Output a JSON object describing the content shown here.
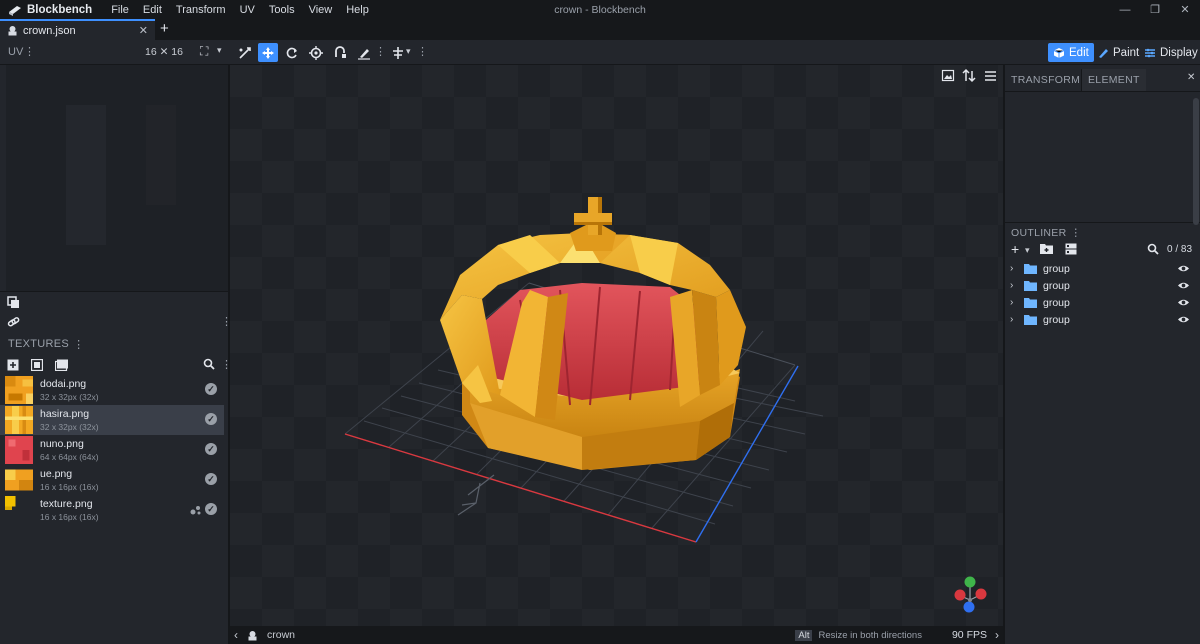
{
  "app": {
    "name": "Blockbench",
    "window_title": "crown - Blockbench",
    "menu": [
      "File",
      "Edit",
      "Transform",
      "UV",
      "Tools",
      "View",
      "Help"
    ]
  },
  "tab": {
    "label": "crown.json",
    "close": "✕",
    "new": "+"
  },
  "uv": {
    "label": "UV",
    "size": "16 ✕ 16"
  },
  "modes": {
    "edit": "Edit",
    "paint": "Paint",
    "display": "Display"
  },
  "textures": {
    "header": "TEXTURES",
    "items": [
      {
        "name": "dodai.png",
        "dims": "32 x 32px (32x)"
      },
      {
        "name": "hasira.png",
        "dims": "32 x 32px (32x)"
      },
      {
        "name": "nuno.png",
        "dims": "64 x 64px (64x)"
      },
      {
        "name": "ue.png",
        "dims": "16 x 16px (16x)"
      },
      {
        "name": "texture.png",
        "dims": "16 x 16px (16x)"
      }
    ]
  },
  "right": {
    "transform_tab": "TRANSFORM",
    "element_tab": "ELEMENT",
    "outliner_header": "OUTLINER",
    "count": "0 / 83",
    "groups": [
      "group",
      "group",
      "group",
      "group"
    ]
  },
  "status": {
    "project": "crown",
    "alt_key": "Alt",
    "hint": "Resize in both directions",
    "fps": "90 FPS"
  },
  "colors": {
    "accent": "#3e90ff",
    "gold": "#e8a628",
    "red": "#d8434c"
  }
}
